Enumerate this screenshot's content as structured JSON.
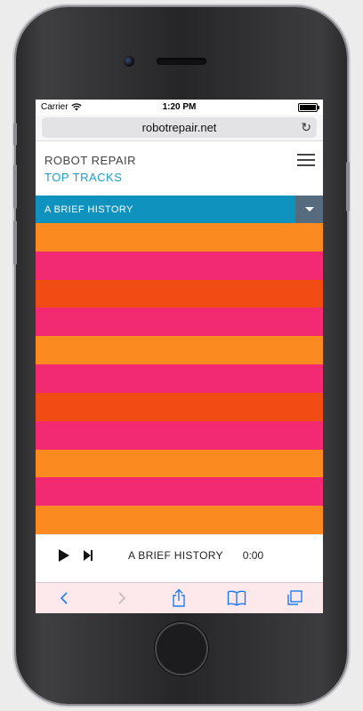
{
  "status_bar": {
    "carrier": "Carrier",
    "time": "1:20 PM"
  },
  "browser": {
    "url": "robotrepair.net",
    "reload_icon": "reload-icon"
  },
  "site": {
    "title": "ROBOT REPAIR",
    "subtitle": "TOP TRACKS"
  },
  "section": {
    "label": "A BRIEF HISTORY"
  },
  "stripes": [
    "#fb8a21",
    "#f22a72",
    "#f04c13",
    "#f22a72",
    "#fb8a21",
    "#f22a72",
    "#f04c13",
    "#f22a72",
    "#fb8a21",
    "#f22a72",
    "#fb8a21"
  ],
  "player": {
    "track": "A BRIEF HISTORY",
    "time": "0:00"
  },
  "colors": {
    "accent": "#1e9ccb",
    "section_bar": "#0f92bd",
    "dropdown": "#566b7e",
    "toolbar_tint": "#fde8ec",
    "ios_blue": "#1e7cf0"
  }
}
